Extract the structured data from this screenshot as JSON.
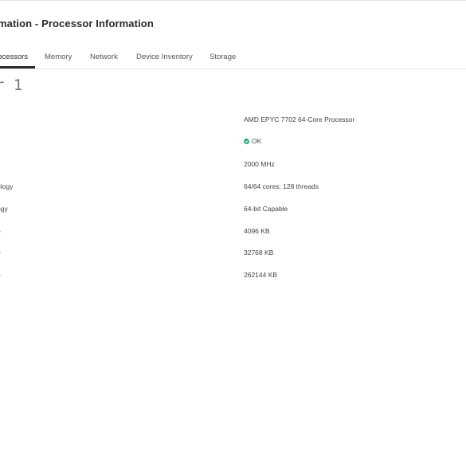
{
  "header": {
    "title": "mation - Processor Information"
  },
  "tabs": [
    {
      "label": "ocessors",
      "active": true
    },
    {
      "label": "Memory",
      "active": false
    },
    {
      "label": "Network",
      "active": false
    },
    {
      "label": "Device Inventory",
      "active": false
    },
    {
      "label": "Storage",
      "active": false
    }
  ],
  "section": {
    "heading": "r 1"
  },
  "details": [
    {
      "label": "",
      "value": "AMD EPYC 7702 64-Core Processor"
    },
    {
      "label": "",
      "value": "OK",
      "status_color": "#1aa784",
      "status_icon": "check-circle-icon"
    },
    {
      "label": "",
      "value": "2000 MHz"
    },
    {
      "label": "ology",
      "value": "64/64 cores; 128 threads"
    },
    {
      "label": "ogy",
      "value": "64-bit Capable"
    },
    {
      "label": "e",
      "value": "4096 KB"
    },
    {
      "label": "e",
      "value": "32768 KB"
    },
    {
      "label": "e",
      "value": "262144 KB"
    }
  ]
}
